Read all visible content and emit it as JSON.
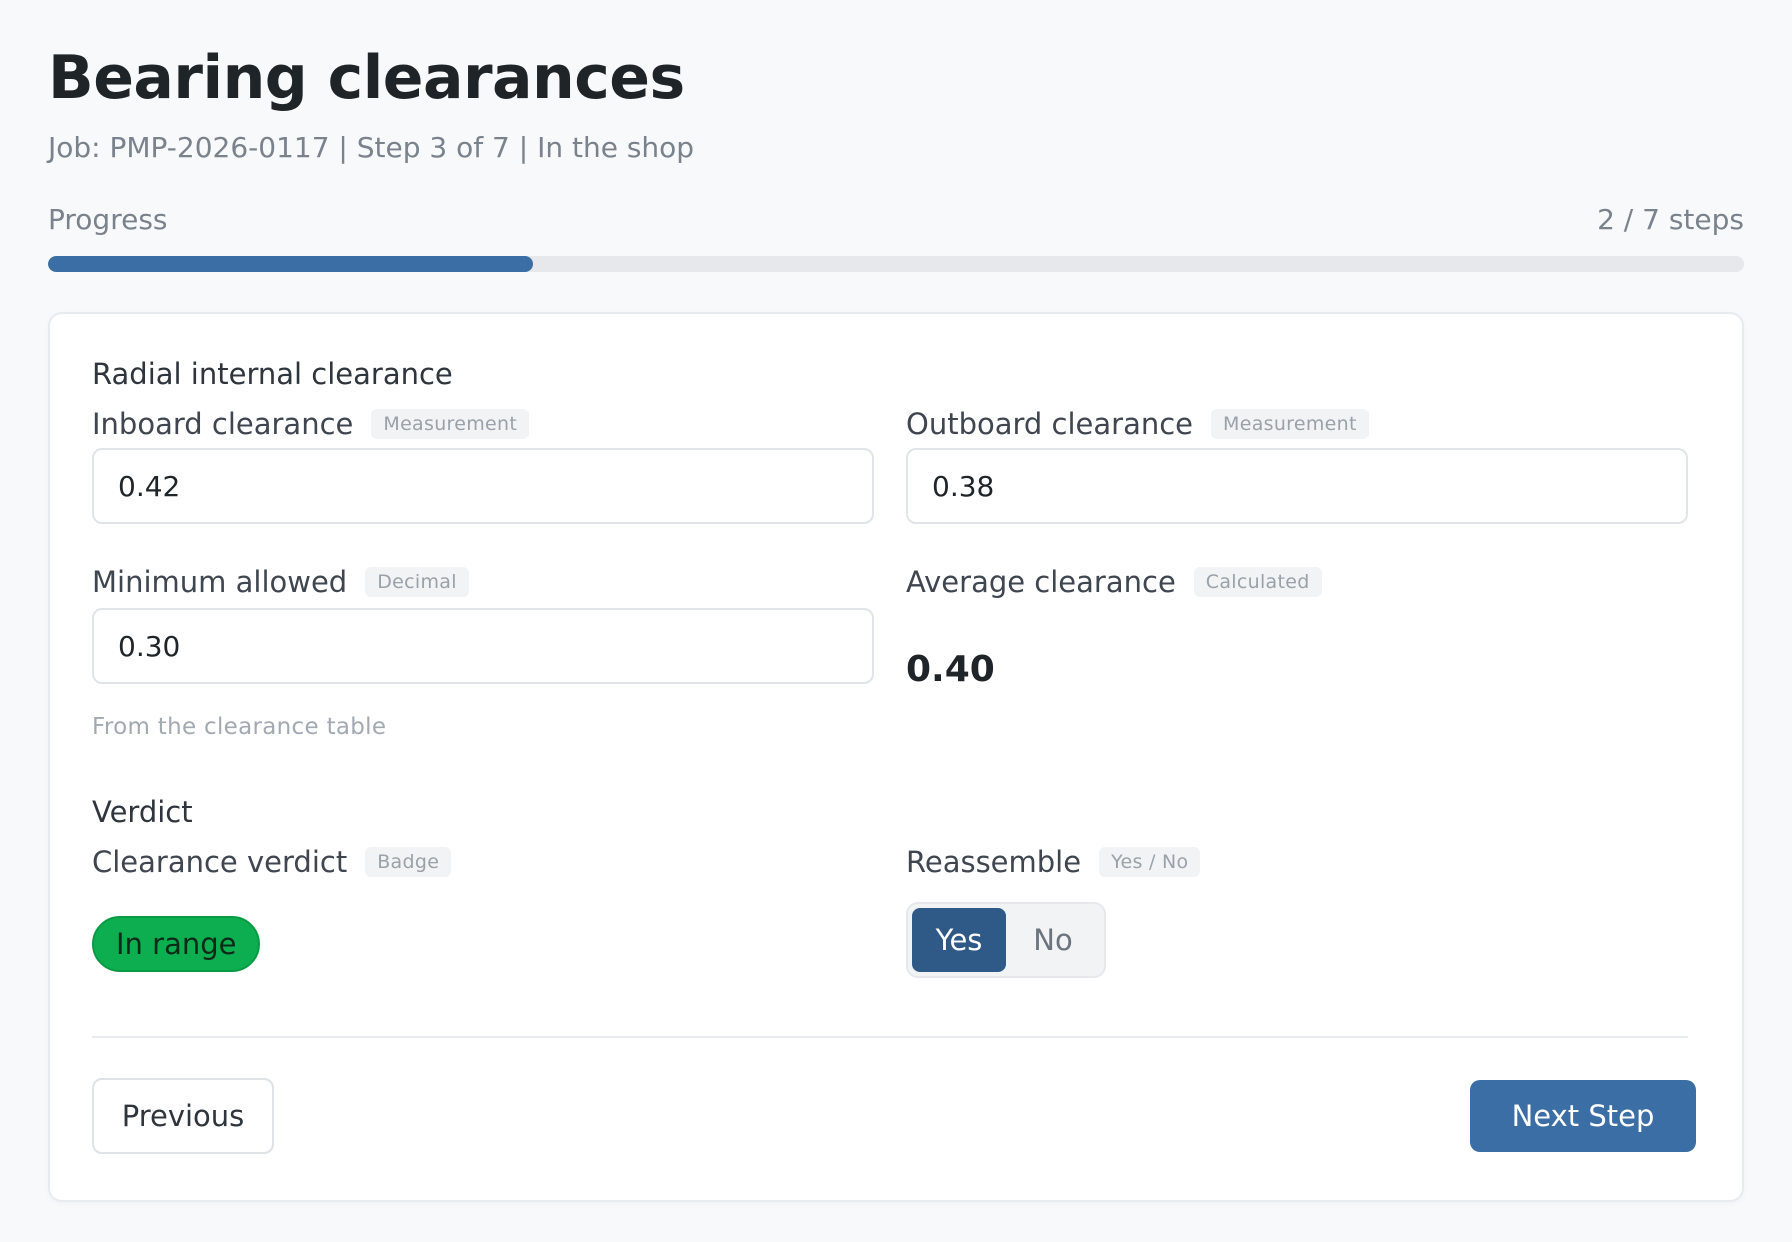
{
  "header": {
    "title": "Bearing clearances",
    "subtitle": "Job: PMP-2026-0117 | Step 3 of 7 | In the shop"
  },
  "progress": {
    "label": "Progress",
    "count_text": "2 / 7 steps",
    "completed": 2,
    "total": 7,
    "fill_color": "#3b6ea4"
  },
  "sections": {
    "radial": {
      "title": "Radial internal clearance",
      "inboard": {
        "label": "Inboard clearance",
        "type_chip": "Measurement",
        "value": "0.42"
      },
      "outboard": {
        "label": "Outboard clearance",
        "type_chip": "Measurement",
        "value": "0.38"
      },
      "minimum": {
        "label": "Minimum allowed",
        "type_chip": "Decimal",
        "value": "0.30",
        "hint": "From the clearance table"
      },
      "average": {
        "label": "Average clearance",
        "type_chip": "Calculated",
        "value": "0.40"
      }
    },
    "verdict": {
      "title": "Verdict",
      "clearance_verdict": {
        "label": "Clearance verdict",
        "type_chip": "Badge",
        "badge_text": "In range",
        "badge_color": "#0cae4f"
      },
      "reassemble": {
        "label": "Reassemble",
        "type_chip": "Yes / No",
        "options": [
          "Yes",
          "No"
        ],
        "selected": "Yes",
        "active_color": "#2f5a87"
      }
    }
  },
  "footer": {
    "previous_label": "Previous",
    "next_label": "Next Step"
  }
}
